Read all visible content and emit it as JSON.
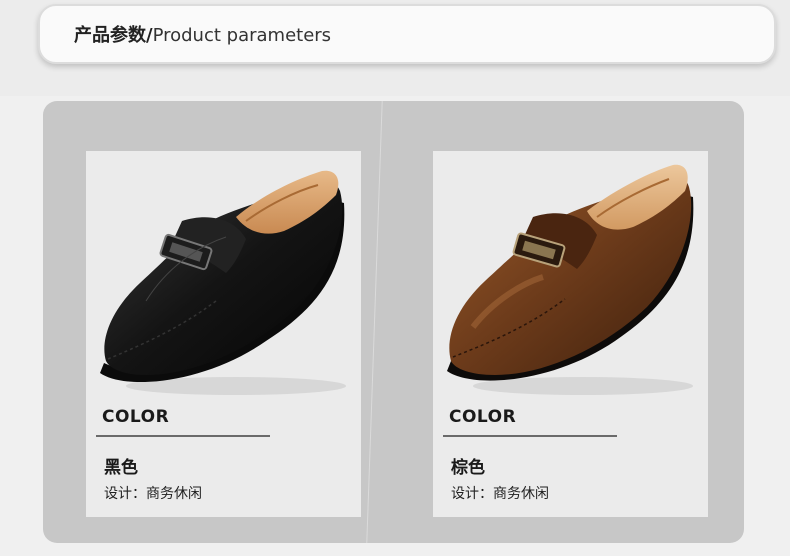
{
  "header": {
    "title_cn": "产品参数/",
    "title_en": "Product parameters"
  },
  "colors": {
    "page_bg": "#f0f0f0",
    "panel_bg": "#c7c7c7",
    "card_bg": "#ebebeb",
    "black_leather": "#141414",
    "brown_leather": "#6b3a1a"
  },
  "products": [
    {
      "color_label": "COLOR",
      "color_name": "黑色",
      "design": "设计：商务休闲",
      "shoe_icon": "black-loafer-mule-image"
    },
    {
      "color_label": "COLOR",
      "color_name": "棕色",
      "design": "设计：商务休闲",
      "shoe_icon": "brown-loafer-mule-image"
    }
  ]
}
